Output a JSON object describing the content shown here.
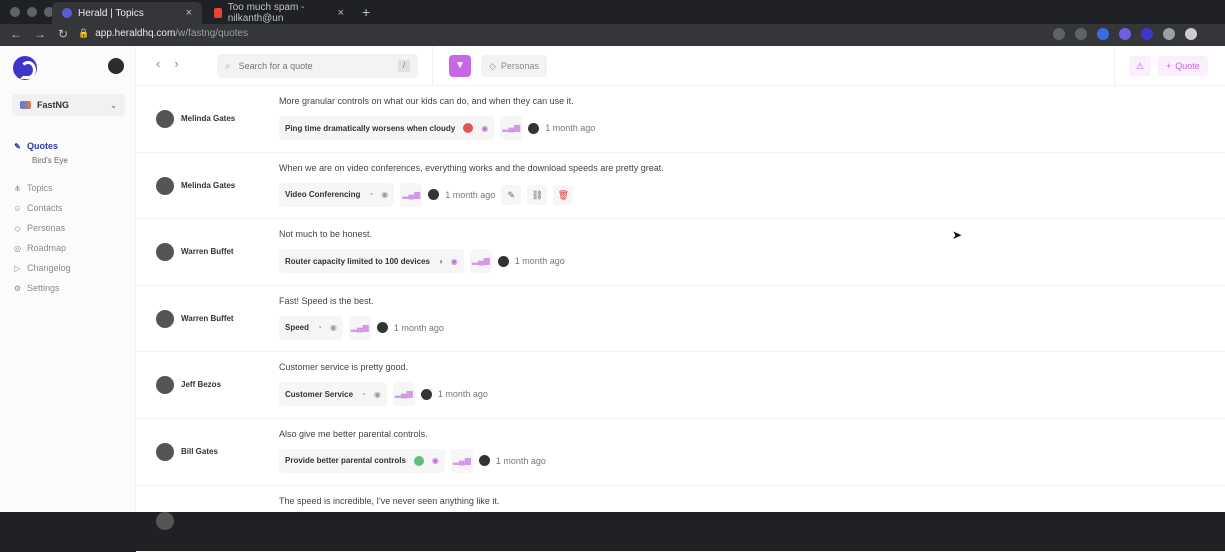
{
  "browser": {
    "tabs": [
      {
        "title": "Herald | Topics",
        "active": true
      },
      {
        "title": "Too much spam - nilkanth@un",
        "active": false
      }
    ],
    "url_host": "app.heraldhq.com",
    "url_path": "/w/fastng/quotes"
  },
  "sidebar": {
    "workspace": "FastNG",
    "items": [
      {
        "label": "Quotes",
        "icon": "quote-icon",
        "active": true
      },
      {
        "label": "Topics",
        "icon": "topics-icon"
      },
      {
        "label": "Contacts",
        "icon": "contacts-icon"
      },
      {
        "label": "Personas",
        "icon": "personas-icon"
      },
      {
        "label": "Roadmap",
        "icon": "roadmap-icon"
      },
      {
        "label": "Changelog",
        "icon": "changelog-icon"
      },
      {
        "label": "Settings",
        "icon": "settings-icon"
      }
    ],
    "subitem": "Bird's Eye"
  },
  "toolbar": {
    "search_placeholder": "Search for a quote",
    "search_shortcut": "/",
    "personas_label": "Personas",
    "quote_label": "Quote"
  },
  "quotes": [
    {
      "person": "Melinda Gates",
      "text": "More granular controls on what our kids can do, and when they can use it.",
      "topic": "Ping time dramatically worsens when cloudy",
      "when": "1 month ago"
    },
    {
      "person": "Melinda Gates",
      "text": "When we are on video conferences, everything works and the download speeds are pretty great.",
      "topic": "Video Conferencing",
      "when": "1 month ago"
    },
    {
      "person": "Warren Buffet",
      "text": "Not much to be honest.",
      "topic": "Router capacity limited to 100 devices",
      "when": "1 month ago"
    },
    {
      "person": "Warren Buffet",
      "text": "Fast! Speed is the best.",
      "topic": "Speed",
      "when": "1 month ago"
    },
    {
      "person": "Jeff Bezos",
      "text": "Customer service is pretty good.",
      "topic": "Customer Service",
      "when": "1 month ago"
    },
    {
      "person": "Bill Gates",
      "text": "Also give me better parental controls.",
      "topic": "Provide better parental controls",
      "when": "1 month ago"
    },
    {
      "person": "",
      "text": "The speed is incredible, I've never seen anything like it.",
      "topic": "",
      "when": ""
    }
  ],
  "colors": {
    "accent": "#c766e6",
    "brand": "#3e37c9",
    "danger": "#e03a3a",
    "success": "#5cbf7a"
  }
}
